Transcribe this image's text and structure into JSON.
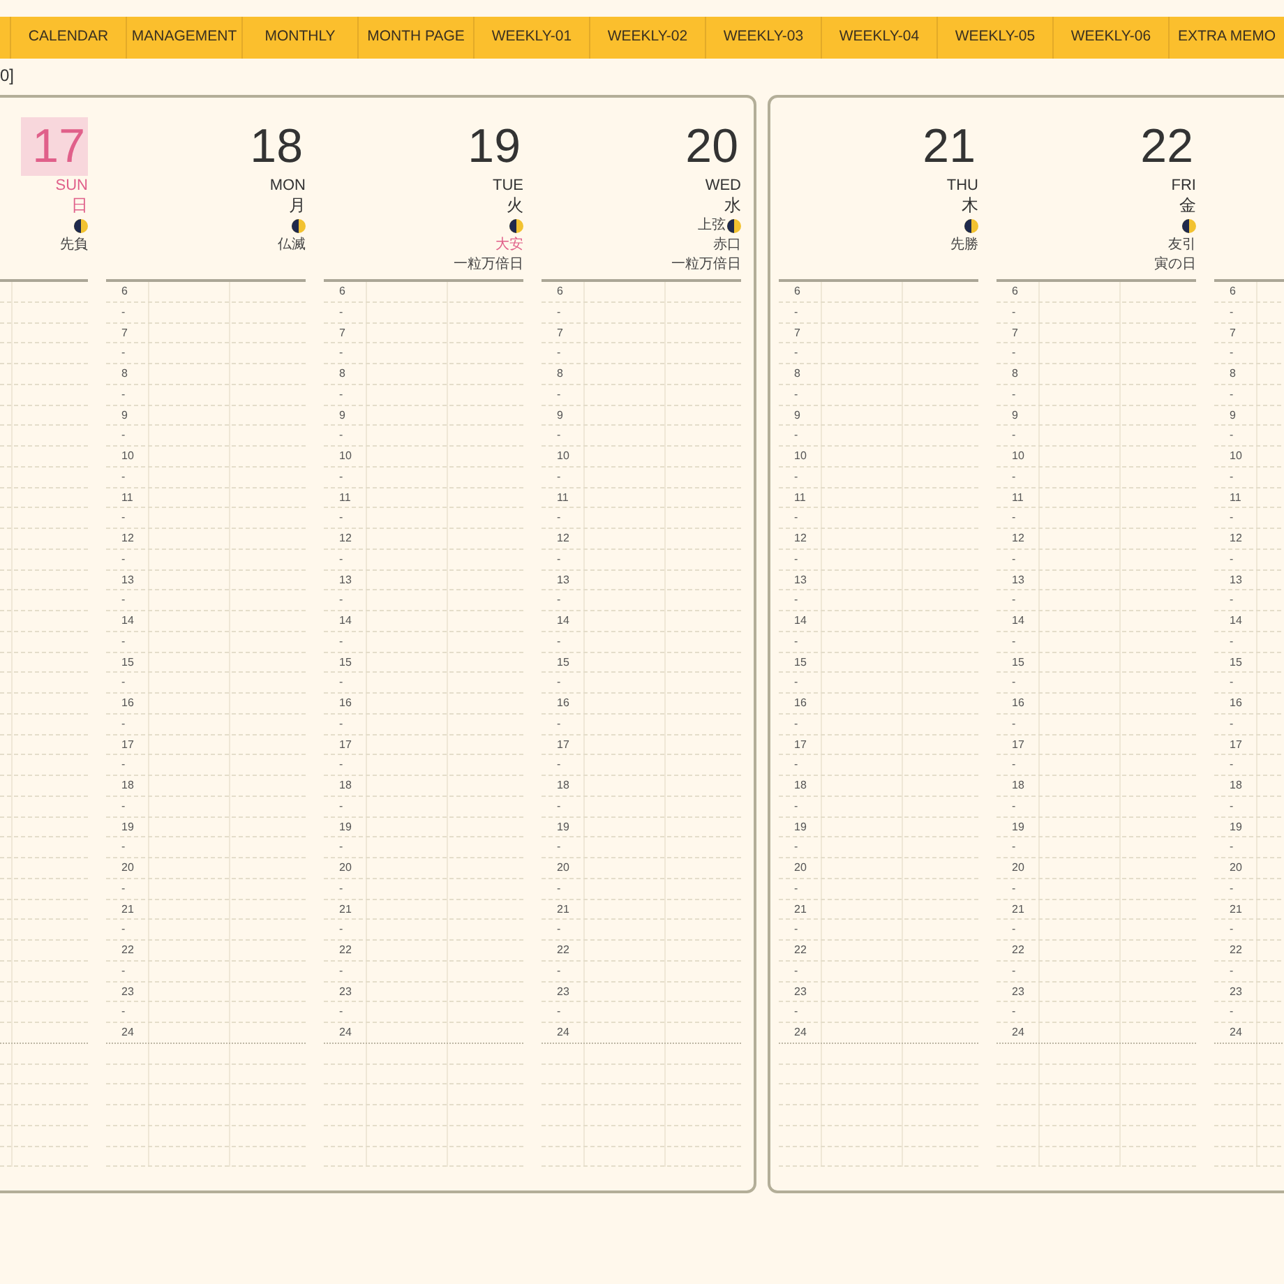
{
  "tabs": [
    {
      "label": "CALENDAR"
    },
    {
      "label": "MANAGEMENT"
    },
    {
      "label": "MONTHLY"
    },
    {
      "label": "MONTH PAGE"
    },
    {
      "label": "WEEKLY-01"
    },
    {
      "label": "WEEKLY-02"
    },
    {
      "label": "WEEKLY-03"
    },
    {
      "label": "WEEKLY-04"
    },
    {
      "label": "WEEKLY-05"
    },
    {
      "label": "WEEKLY-06"
    },
    {
      "label": "EXTRA MEMO"
    }
  ],
  "page_label": "0]",
  "pages": [
    {
      "columns": [
        {
          "date": "17",
          "weekday": "SUN",
          "weekday_kanji": "日",
          "holiday": true,
          "rokuyo": "先負",
          "rokuyo_highlight": false
        },
        {
          "date": "18",
          "weekday": "MON",
          "weekday_kanji": "月",
          "holiday": false,
          "rokuyo": "仏滅",
          "rokuyo_highlight": false,
          "time_labels": [
            "6",
            "-",
            "7",
            "-",
            "8",
            "-",
            "9",
            "-",
            "10",
            "-",
            "11",
            "-",
            "12",
            "-",
            "13",
            "-",
            "14",
            "-",
            "15",
            "-",
            "16",
            "-",
            "17",
            "-",
            "18",
            "-",
            "19",
            "-",
            "20",
            "-",
            "21",
            "-",
            "22",
            "-",
            "23",
            "-",
            "24"
          ]
        },
        {
          "date": "19",
          "weekday": "TUE",
          "weekday_kanji": "火",
          "holiday": false,
          "rokuyo": "大安",
          "rokuyo_highlight": true,
          "special_day": "一粒万倍日",
          "time_labels": [
            "6",
            "-",
            "7",
            "-",
            "8",
            "-",
            "9",
            "-",
            "10",
            "-",
            "11",
            "-",
            "12",
            "-",
            "13",
            "-",
            "14",
            "-",
            "15",
            "-",
            "16",
            "-",
            "17",
            "-",
            "18",
            "-",
            "19",
            "-",
            "20",
            "-",
            "21",
            "-",
            "22",
            "-",
            "23",
            "-",
            "24"
          ]
        },
        {
          "date": "20",
          "weekday": "WED",
          "weekday_kanji": "水",
          "holiday": false,
          "moon_label": "上弦",
          "rokuyo": "赤口",
          "rokuyo_highlight": false,
          "special_day": "一粒万倍日",
          "time_labels": [
            "6",
            "-",
            "7",
            "-",
            "8",
            "-",
            "9",
            "-",
            "10",
            "-",
            "11",
            "-",
            "12",
            "-",
            "13",
            "-",
            "14",
            "-",
            "15",
            "-",
            "16",
            "-",
            "17",
            "-",
            "18",
            "-",
            "19",
            "-",
            "20",
            "-",
            "21",
            "-",
            "22",
            "-",
            "23",
            "-",
            "24"
          ]
        }
      ]
    },
    {
      "columns": [
        {
          "date": "21",
          "weekday": "THU",
          "weekday_kanji": "木",
          "holiday": false,
          "rokuyo": "先勝",
          "rokuyo_highlight": false,
          "time_labels": [
            "6",
            "-",
            "7",
            "-",
            "8",
            "-",
            "9",
            "-",
            "10",
            "-",
            "11",
            "-",
            "12",
            "-",
            "13",
            "-",
            "14",
            "-",
            "15",
            "-",
            "16",
            "-",
            "17",
            "-",
            "18",
            "-",
            "19",
            "-",
            "20",
            "-",
            "21",
            "-",
            "22",
            "-",
            "23",
            "-",
            "24"
          ]
        },
        {
          "date": "22",
          "weekday": "FRI",
          "weekday_kanji": "金",
          "holiday": false,
          "rokuyo": "友引",
          "rokuyo_highlight": false,
          "special_day": "寅の日",
          "time_labels": [
            "6",
            "-",
            "7",
            "-",
            "8",
            "-",
            "9",
            "-",
            "10",
            "-",
            "11",
            "-",
            "12",
            "-",
            "13",
            "-",
            "14",
            "-",
            "15",
            "-",
            "16",
            "-",
            "17",
            "-",
            "18",
            "-",
            "19",
            "-",
            "20",
            "-",
            "21",
            "-",
            "22",
            "-",
            "23",
            "-",
            "24"
          ]
        },
        {
          "time_labels": [
            "6",
            "-",
            "7",
            "-",
            "8",
            "-",
            "9",
            "-",
            "10",
            "-",
            "11",
            "-",
            "12",
            "-",
            "13",
            "-",
            "14",
            "-",
            "15",
            "-",
            "16",
            "-",
            "17",
            "-",
            "18",
            "-",
            "19",
            "-",
            "20",
            "-",
            "21",
            "-",
            "22",
            "-",
            "23",
            "-",
            "24"
          ]
        }
      ]
    }
  ]
}
